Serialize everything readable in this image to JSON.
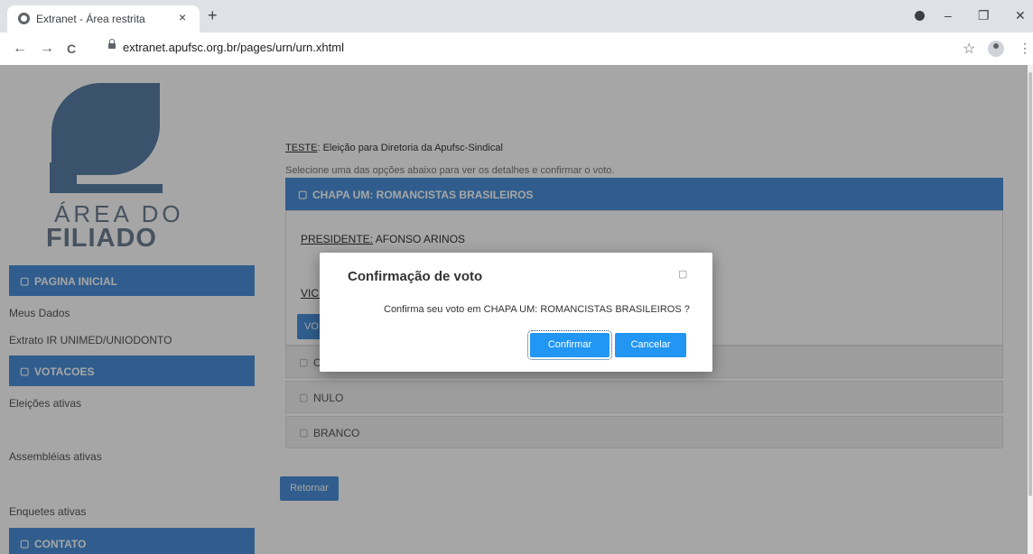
{
  "browser": {
    "tab_title": "Extranet - Área restrita",
    "tab_close": "×",
    "new_tab": "+",
    "url": "extranet.apufsc.org.br/pages/urn/urn.xhtml",
    "minimize": "–",
    "restore": "❐",
    "close": "✕",
    "back": "←",
    "forward": "→",
    "reload": "C",
    "star": "☆",
    "menu": "⋮"
  },
  "logo": {
    "line1": "ÁREA DO",
    "line2": "FILIADO"
  },
  "sidebar": {
    "sections": [
      {
        "label": "PAGINA INICIAL",
        "icon": "square-icon"
      },
      {
        "label": "VOTACOES",
        "icon": "square-icon"
      },
      {
        "label": "CONTATO",
        "icon": "square-icon"
      }
    ],
    "links": [
      "Meus Dados",
      "Extrato IR UNIMED/UNIODONTO",
      "Eleições ativas",
      "Assembléias ativas",
      "Enquetes ativas"
    ]
  },
  "main": {
    "heading_prefix": "TESTE",
    "heading_rest": ": Eleição para Diretoria da Apufsc-Sindical",
    "instruction": "Selecione uma das opções abaixo para ver os detalhes e confirmar o voto.",
    "expanded_option": "CHAPA UM: ROMANCISTAS BRASILEIROS",
    "president_label": "PRESIDENTE:",
    "president_name": " AFONSO ARINOS",
    "vice_label": "VICE",
    "vote_button_label": "VO",
    "options": [
      "C",
      "NULO",
      "BRANCO"
    ],
    "return_button": "Retornar"
  },
  "dialog": {
    "title": "Confirmação de voto",
    "message": "Confirma seu voto em CHAPA UM: ROMANCISTAS BRASILEIROS ?",
    "confirm_label": "Confirmar",
    "cancel_label": "Cancelar"
  },
  "colors": {
    "primary": "#4a90d9",
    "dialog_button": "#2196f3",
    "logo": "#5a7fa6"
  }
}
